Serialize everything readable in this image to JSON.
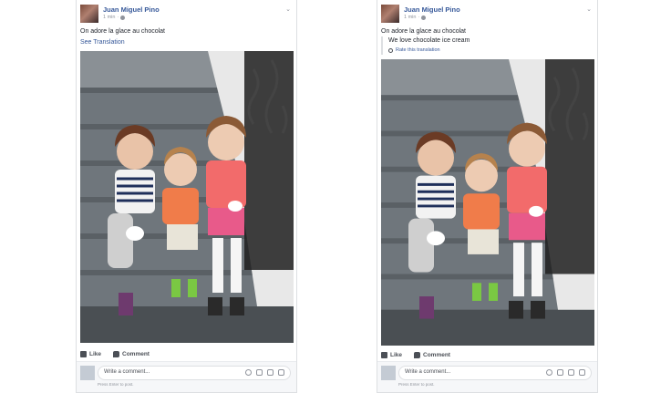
{
  "posts": [
    {
      "author": "Juan Miguel Pino",
      "timestamp": "1 min",
      "separator": "·",
      "text": "On adore la glace au chocolat",
      "see_translation": "See Translation",
      "actions": {
        "like": "Like",
        "comment": "Comment"
      },
      "comment_placeholder": "Write a comment...",
      "press_enter": "Press Enter to post."
    },
    {
      "author": "Juan Miguel Pino",
      "timestamp": "1 min",
      "separator": "·",
      "text": "On adore la glace au chocolat",
      "translated_text": "We love chocolate ice cream",
      "rate_translation": "Rate this translation",
      "actions": {
        "like": "Like",
        "comment": "Comment"
      },
      "comment_placeholder": "Write a comment...",
      "press_enter": "Press Enter to post."
    }
  ],
  "icons": {
    "options": "chevron-down-icon",
    "privacy": "globe-icon",
    "like": "thumbs-up-icon",
    "comment": "comment-bubble-icon",
    "rate": "gear-icon",
    "comment_tools": [
      "emoji-icon",
      "camera-icon",
      "gif-icon",
      "sticker-icon"
    ]
  },
  "colors": {
    "link": "#365899",
    "text": "#1d2129",
    "meta": "#90949c",
    "border": "#dddfe2"
  }
}
